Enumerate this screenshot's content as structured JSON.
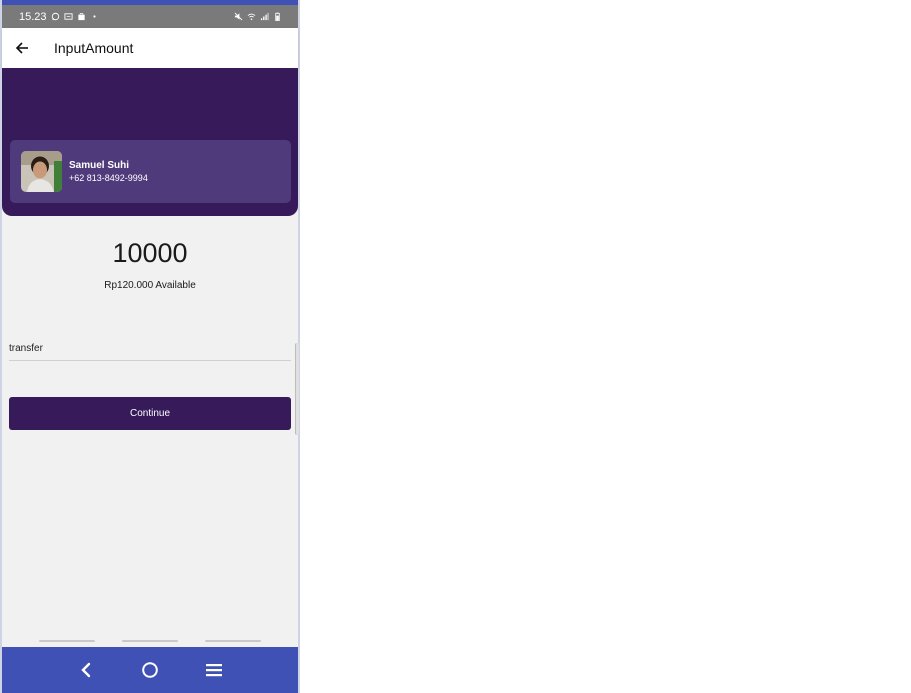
{
  "status_bar": {
    "time": "15.23",
    "left_icons": [
      "whatsapp-icon",
      "message-icon",
      "bag-icon",
      "dot-icon"
    ],
    "right_icons": [
      "mute-icon",
      "wifi-icon",
      "signal-icon",
      "battery-icon"
    ]
  },
  "app_bar": {
    "title": "InputAmount",
    "back_icon": "arrow-left-icon"
  },
  "contact": {
    "name": "Samuel Suhi",
    "phone": "+62 813-8492-9994"
  },
  "amount": {
    "value": "10000",
    "available": "Rp120.000 Available"
  },
  "note_field": {
    "value": "transfer"
  },
  "continue_button": {
    "label": "Continue"
  },
  "nav_bar": {
    "icons": [
      "back-nav-icon",
      "home-nav-icon",
      "menu-nav-icon"
    ]
  },
  "colors": {
    "primary": "#361a5a",
    "card": "#4f3a7b",
    "nav_bar": "#3f51b5",
    "background": "#f1f1f1"
  }
}
